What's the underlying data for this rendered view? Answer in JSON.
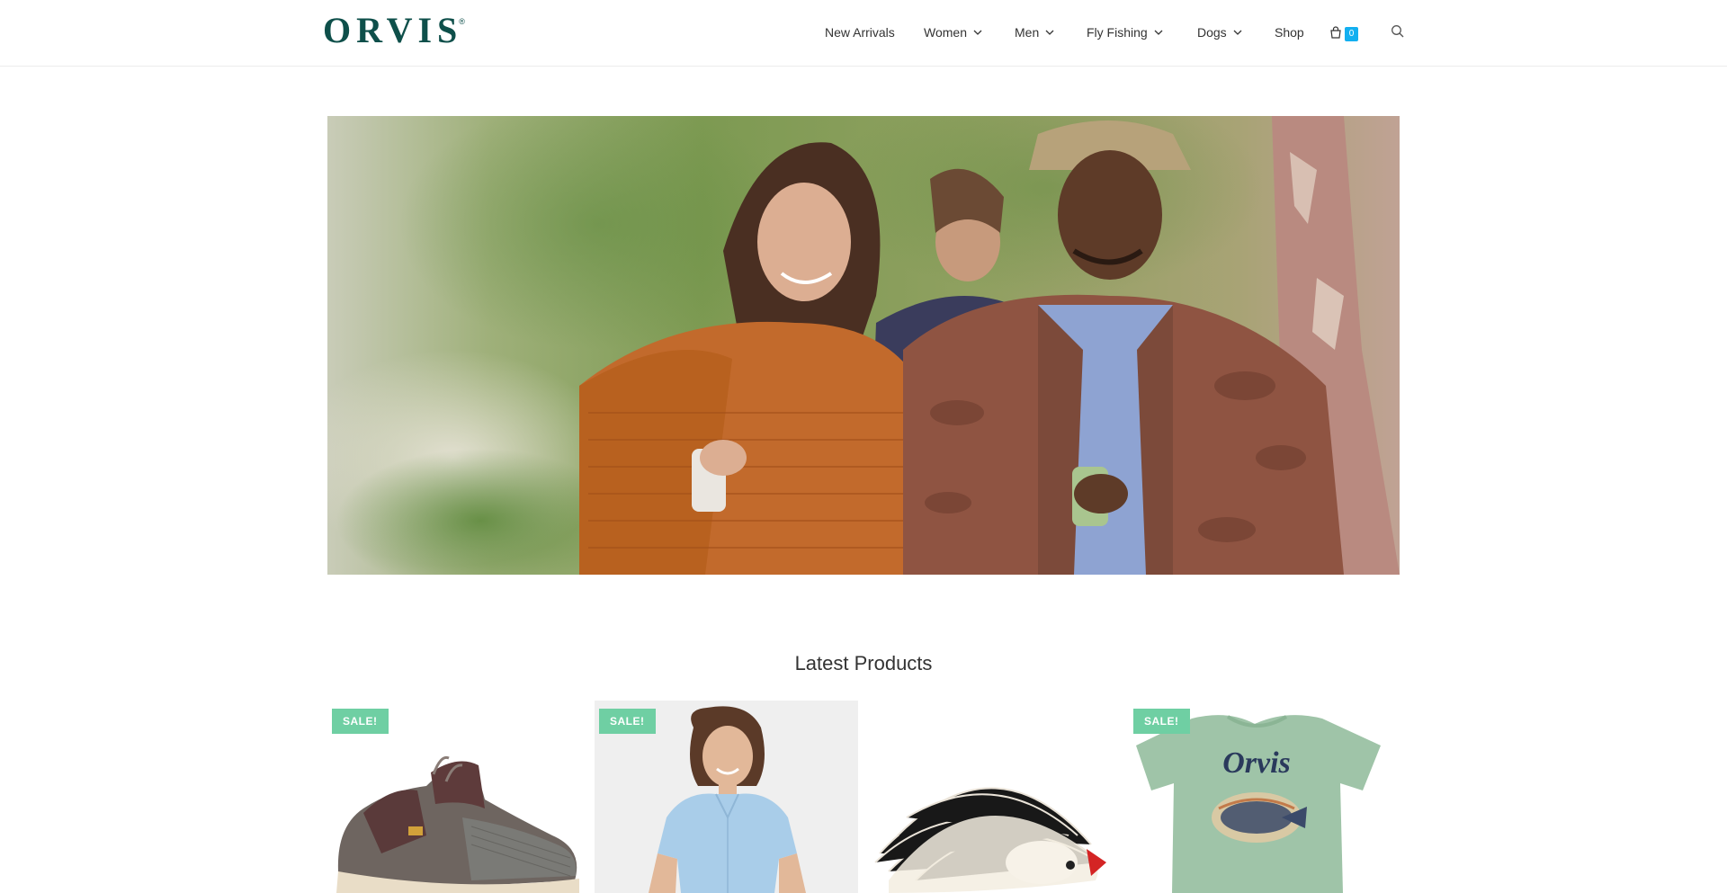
{
  "header": {
    "logo_text": "ORVIS",
    "logo_mark": "®",
    "nav": [
      {
        "label": "New Arrivals",
        "has_dropdown": false
      },
      {
        "label": "Women",
        "has_dropdown": true
      },
      {
        "label": "Men",
        "has_dropdown": true
      },
      {
        "label": "Fly Fishing",
        "has_dropdown": true
      },
      {
        "label": "Dogs",
        "has_dropdown": true
      },
      {
        "label": "Shop",
        "has_dropdown": false
      }
    ],
    "cart": {
      "icon": "shopping-bag-icon",
      "count": "0"
    },
    "search": {
      "icon": "search-icon"
    }
  },
  "hero": {
    "icon": "lifestyle-photo"
  },
  "latest_products": {
    "title": "Latest Products",
    "items": [
      {
        "badge": "SALE!",
        "image": "hiking-shoe-image"
      },
      {
        "badge": "SALE!",
        "image": "womens-shirt-image"
      },
      {
        "badge": "",
        "image": "fishing-fly-image"
      },
      {
        "badge": "SALE!",
        "image": "graphic-tshirt-image",
        "print_text": "Orvis"
      }
    ]
  },
  "colors": {
    "brand": "#0e4f4a",
    "sale_badge": "#6fcfa3",
    "cart_badge": "#13aff0"
  }
}
